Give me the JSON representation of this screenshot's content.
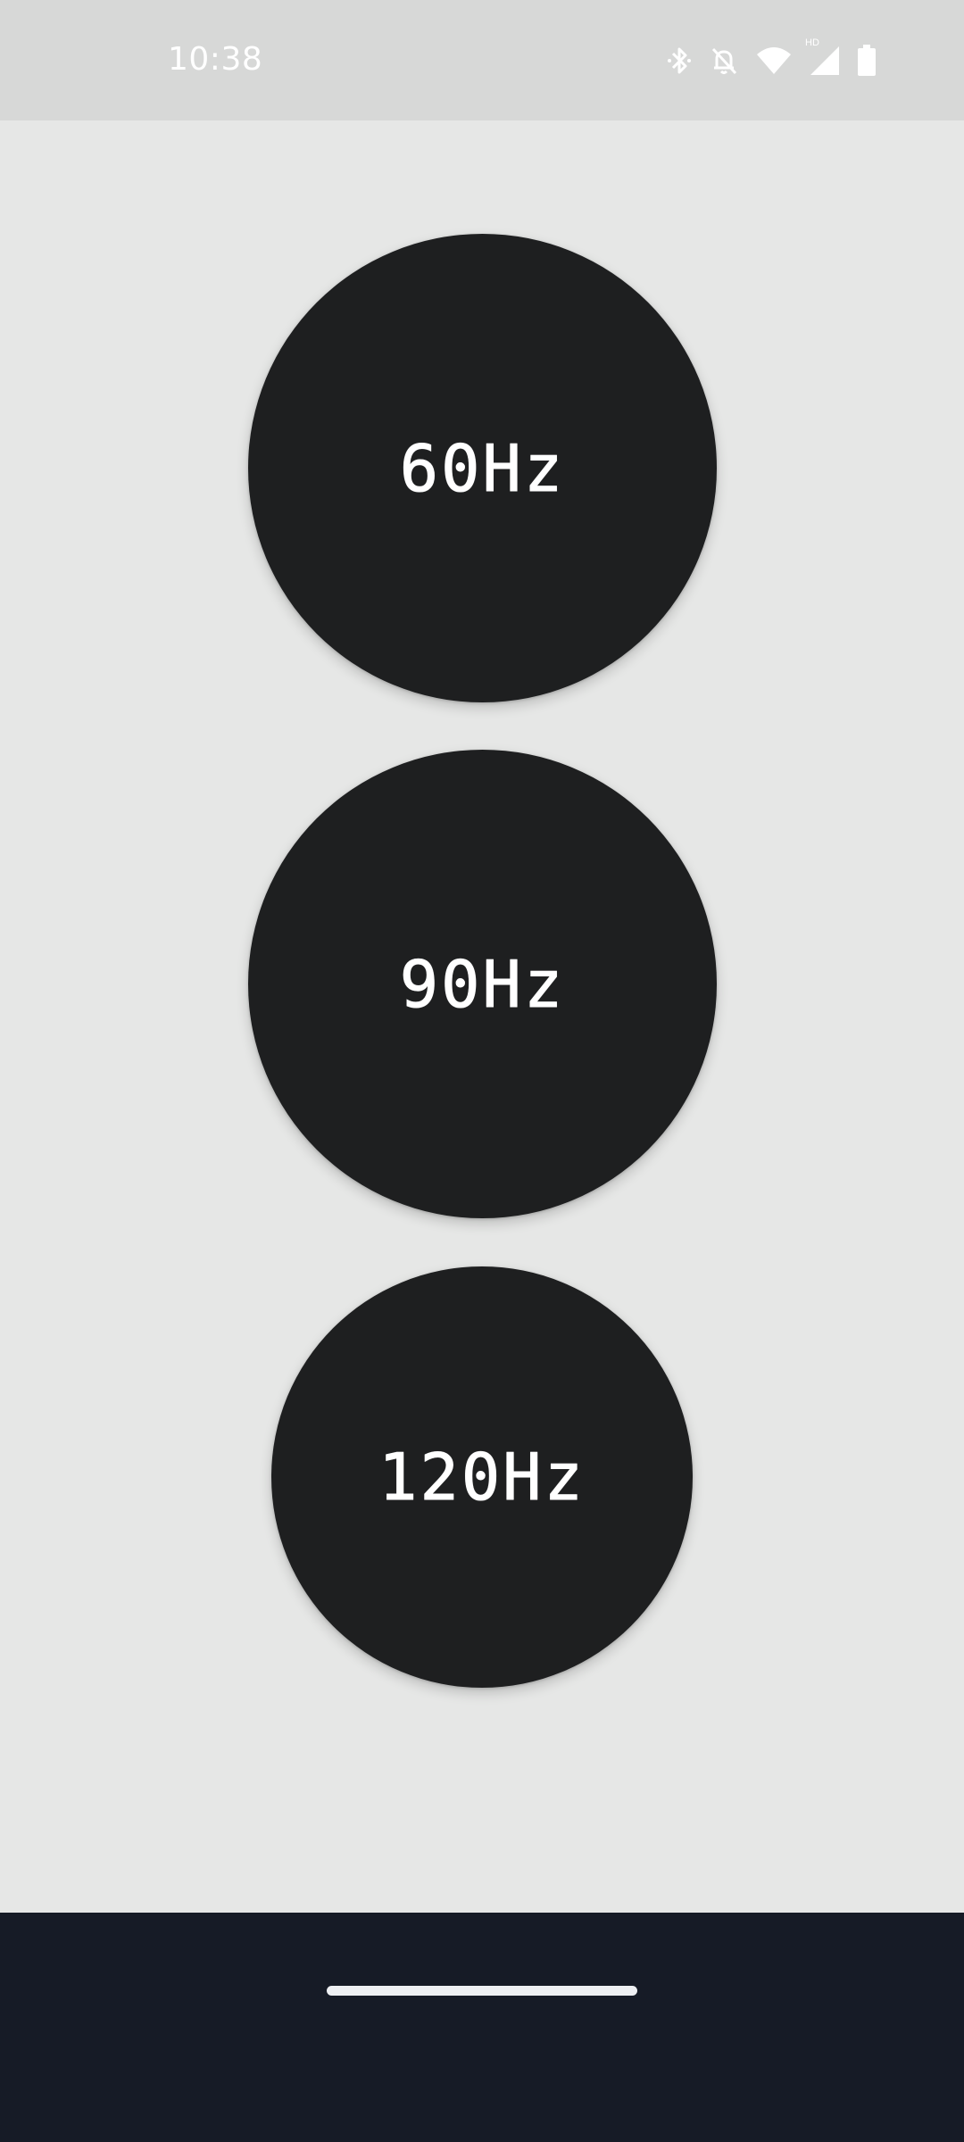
{
  "status_bar": {
    "time": "10:38",
    "icons": [
      "bluetooth-icon",
      "bell-off-icon",
      "wifi-icon",
      "cell-signal-icon",
      "battery-icon"
    ],
    "network_badge": "HD"
  },
  "buttons": [
    {
      "label": "60Hz"
    },
    {
      "label": "90Hz"
    },
    {
      "label": "120Hz"
    }
  ],
  "colors": {
    "background": "#e6e7e6",
    "status_bar": "#d7d8d7",
    "button": "#1e1f20",
    "nav_bar": "#161b26",
    "text": "#ffffff"
  }
}
